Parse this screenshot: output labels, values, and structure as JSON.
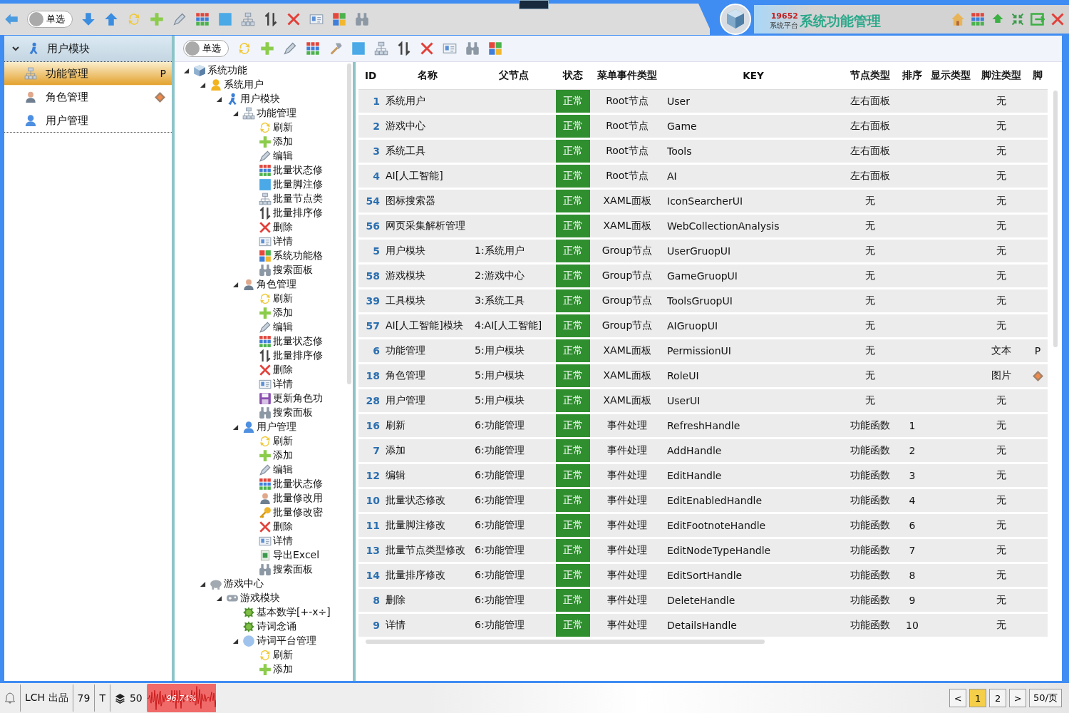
{
  "title_bar": {
    "toolbar": [
      {
        "kind": "back"
      },
      {
        "kind": "toggle",
        "label": "单选",
        "on": false
      },
      {
        "kind": "down"
      },
      {
        "kind": "up"
      },
      {
        "kind": "refresh"
      },
      {
        "kind": "add"
      },
      {
        "kind": "edit"
      },
      {
        "kind": "grid"
      },
      {
        "kind": "square"
      },
      {
        "kind": "tree"
      },
      {
        "kind": "sort"
      },
      {
        "kind": "delete"
      },
      {
        "kind": "card"
      },
      {
        "kind": "tiles"
      },
      {
        "kind": "binoculars"
      }
    ],
    "count": "19652",
    "platform": "系统平台",
    "title": "系统功能管理",
    "controls": [
      {
        "kind": "home"
      },
      {
        "kind": "grid"
      },
      {
        "kind": "upgreen"
      },
      {
        "kind": "shrink"
      },
      {
        "kind": "exit"
      },
      {
        "kind": "close"
      }
    ]
  },
  "sidebar": {
    "header": {
      "label": "用户模块",
      "expanded": true
    },
    "items": [
      {
        "label": "功能管理",
        "kind": "tree",
        "selected": true,
        "tail": {
          "kind": "text",
          "text": "P"
        }
      },
      {
        "label": "角色管理",
        "kind": "role",
        "selected": false,
        "tail": {
          "kind": "diamond"
        }
      },
      {
        "label": "用户管理",
        "kind": "people",
        "selected": false
      }
    ]
  },
  "toolbar": [
    {
      "kind": "toggle",
      "label": "单选",
      "on": false
    },
    {
      "kind": "refresh"
    },
    {
      "kind": "add"
    },
    {
      "kind": "edit"
    },
    {
      "kind": "grid"
    },
    {
      "kind": "hammer"
    },
    {
      "kind": "square"
    },
    {
      "kind": "tree"
    },
    {
      "kind": "sort"
    },
    {
      "kind": "delete"
    },
    {
      "kind": "card"
    },
    {
      "kind": "binoculars"
    },
    {
      "kind": "tiles"
    }
  ],
  "tree": [
    {
      "label": "系统功能",
      "kind": "cube",
      "expanded": true,
      "children": [
        {
          "label": "系统用户",
          "kind": "user",
          "expanded": true,
          "children": [
            {
              "label": "用户模块",
              "kind": "runner",
              "expanded": true,
              "children": [
                {
                  "label": "功能管理",
                  "kind": "tree",
                  "expanded": true,
                  "children": [
                    {
                      "label": "刷新",
                      "kind": "refresh"
                    },
                    {
                      "label": "添加",
                      "kind": "add"
                    },
                    {
                      "label": "编辑",
                      "kind": "edit"
                    },
                    {
                      "label": "批量状态修",
                      "kind": "grid"
                    },
                    {
                      "label": "批量脚注修",
                      "kind": "square"
                    },
                    {
                      "label": "批量节点类",
                      "kind": "tree"
                    },
                    {
                      "label": "批量排序修",
                      "kind": "sort"
                    },
                    {
                      "label": "删除",
                      "kind": "delete"
                    },
                    {
                      "label": "详情",
                      "kind": "card"
                    },
                    {
                      "label": "系统功能格",
                      "kind": "tiles"
                    },
                    {
                      "label": "搜索面板",
                      "kind": "binoculars"
                    }
                  ]
                },
                {
                  "label": "角色管理",
                  "kind": "role",
                  "expanded": true,
                  "children": [
                    {
                      "label": "刷新",
                      "kind": "refresh"
                    },
                    {
                      "label": "添加",
                      "kind": "add"
                    },
                    {
                      "label": "编辑",
                      "kind": "edit"
                    },
                    {
                      "label": "批量状态修",
                      "kind": "grid"
                    },
                    {
                      "label": "批量排序修",
                      "kind": "sort"
                    },
                    {
                      "label": "删除",
                      "kind": "delete"
                    },
                    {
                      "label": "详情",
                      "kind": "card"
                    },
                    {
                      "label": "更新角色功",
                      "kind": "save"
                    },
                    {
                      "label": "搜索面板",
                      "kind": "binoculars"
                    }
                  ]
                },
                {
                  "label": "用户管理",
                  "kind": "people",
                  "expanded": true,
                  "children": [
                    {
                      "label": "刷新",
                      "kind": "refresh"
                    },
                    {
                      "label": "添加",
                      "kind": "add"
                    },
                    {
                      "label": "编辑",
                      "kind": "edit"
                    },
                    {
                      "label": "批量状态修",
                      "kind": "grid"
                    },
                    {
                      "label": "批量修改用",
                      "kind": "role"
                    },
                    {
                      "label": "批量修改密",
                      "kind": "key"
                    },
                    {
                      "label": "删除",
                      "kind": "delete"
                    },
                    {
                      "label": "详情",
                      "kind": "card"
                    },
                    {
                      "label": "导出Excel",
                      "kind": "excel"
                    },
                    {
                      "label": "搜索面板",
                      "kind": "binoculars"
                    }
                  ]
                }
              ]
            }
          ]
        },
        {
          "label": "游戏中心",
          "kind": "elephant",
          "expanded": true,
          "children": [
            {
              "label": "游戏模块",
              "kind": "gamepad",
              "expanded": true,
              "children": [
                {
                  "label": "基本数学[+-x÷]",
                  "kind": "bug"
                },
                {
                  "label": "诗词念诵",
                  "kind": "bug"
                },
                {
                  "label": "诗词平台管理",
                  "kind": "circle",
                  "expanded": true,
                  "children": [
                    {
                      "label": "刷新",
                      "kind": "refresh"
                    },
                    {
                      "label": "添加",
                      "kind": "add"
                    }
                  ]
                }
              ]
            }
          ]
        }
      ]
    }
  ],
  "table": {
    "columns": [
      "ID",
      "名称",
      "父节点",
      "状态",
      "菜单事件类型",
      "KEY",
      "节点类型",
      "排序",
      "显示类型",
      "脚注类型",
      "脚"
    ],
    "rows": [
      {
        "id": "1",
        "name": "系统用户",
        "status": "正常",
        "event_type": "Root节点",
        "key": "User",
        "node_type": "左右面板",
        "footnote_type": "无"
      },
      {
        "id": "2",
        "name": "游戏中心",
        "status": "正常",
        "event_type": "Root节点",
        "key": "Game",
        "node_type": "左右面板",
        "footnote_type": "无"
      },
      {
        "id": "3",
        "name": "系统工具",
        "status": "正常",
        "event_type": "Root节点",
        "key": "Tools",
        "node_type": "左右面板",
        "footnote_type": "无"
      },
      {
        "id": "4",
        "name": "AI[人工智能]",
        "status": "正常",
        "event_type": "Root节点",
        "key": "AI",
        "node_type": "左右面板",
        "footnote_type": "无"
      },
      {
        "id": "54",
        "name": "图标搜索器",
        "status": "正常",
        "event_type": "XAML面板",
        "key": "IconSearcherUI",
        "node_type": "无",
        "footnote_type": "无"
      },
      {
        "id": "56",
        "name": "网页采集解析管理",
        "status": "正常",
        "event_type": "XAML面板",
        "key": "WebCollectionAnalysis",
        "node_type": "无",
        "footnote_type": "无"
      },
      {
        "id": "5",
        "name": "用户模块",
        "parent": "1:系统用户",
        "status": "正常",
        "event_type": "Group节点",
        "key": "UserGruopUI",
        "node_type": "无",
        "footnote_type": "无"
      },
      {
        "id": "58",
        "name": "游戏模块",
        "parent": "2:游戏中心",
        "status": "正常",
        "event_type": "Group节点",
        "key": "GameGruopUI",
        "node_type": "无",
        "footnote_type": "无"
      },
      {
        "id": "39",
        "name": "工具模块",
        "parent": "3:系统工具",
        "status": "正常",
        "event_type": "Group节点",
        "key": "ToolsGruopUI",
        "node_type": "无",
        "footnote_type": "无"
      },
      {
        "id": "57",
        "name": "AI[人工智能]模块",
        "parent": "4:AI[人工智能]",
        "status": "正常",
        "event_type": "Group节点",
        "key": "AIGruopUI",
        "node_type": "无",
        "footnote_type": "无"
      },
      {
        "id": "6",
        "name": "功能管理",
        "parent": "5:用户模块",
        "status": "正常",
        "event_type": "XAML面板",
        "key": "PermissionUI",
        "node_type": "无",
        "footnote_type": "文本",
        "tail": {
          "kind": "text",
          "text": "P"
        }
      },
      {
        "id": "18",
        "name": "角色管理",
        "parent": "5:用户模块",
        "status": "正常",
        "event_type": "XAML面板",
        "key": "RoleUI",
        "node_type": "无",
        "footnote_type": "图片",
        "tail": {
          "kind": "diamond"
        }
      },
      {
        "id": "28",
        "name": "用户管理",
        "parent": "5:用户模块",
        "status": "正常",
        "event_type": "XAML面板",
        "key": "UserUI",
        "node_type": "无",
        "footnote_type": "无"
      },
      {
        "id": "16",
        "name": "刷新",
        "parent": "6:功能管理",
        "status": "正常",
        "event_type": "事件处理",
        "key": "RefreshHandle",
        "node_type": "功能函数",
        "sort": "1",
        "footnote_type": "无"
      },
      {
        "id": "7",
        "name": "添加",
        "parent": "6:功能管理",
        "status": "正常",
        "event_type": "事件处理",
        "key": "AddHandle",
        "node_type": "功能函数",
        "sort": "2",
        "footnote_type": "无"
      },
      {
        "id": "12",
        "name": "编辑",
        "parent": "6:功能管理",
        "status": "正常",
        "event_type": "事件处理",
        "key": "EditHandle",
        "node_type": "功能函数",
        "sort": "3",
        "footnote_type": "无"
      },
      {
        "id": "10",
        "name": "批量状态修改",
        "parent": "6:功能管理",
        "status": "正常",
        "event_type": "事件处理",
        "key": "EditEnabledHandle",
        "node_type": "功能函数",
        "sort": "4",
        "footnote_type": "无"
      },
      {
        "id": "11",
        "name": "批量脚注修改",
        "parent": "6:功能管理",
        "status": "正常",
        "event_type": "事件处理",
        "key": "EditFootnoteHandle",
        "node_type": "功能函数",
        "sort": "6",
        "footnote_type": "无"
      },
      {
        "id": "13",
        "name": "批量节点类型修改",
        "parent": "6:功能管理",
        "status": "正常",
        "event_type": "事件处理",
        "key": "EditNodeTypeHandle",
        "node_type": "功能函数",
        "sort": "7",
        "footnote_type": "无"
      },
      {
        "id": "14",
        "name": "批量排序修改",
        "parent": "6:功能管理",
        "status": "正常",
        "event_type": "事件处理",
        "key": "EditSortHandle",
        "node_type": "功能函数",
        "sort": "8",
        "footnote_type": "无"
      },
      {
        "id": "8",
        "name": "删除",
        "parent": "6:功能管理",
        "status": "正常",
        "event_type": "事件处理",
        "key": "DeleteHandle",
        "node_type": "功能函数",
        "sort": "9",
        "footnote_type": "无"
      },
      {
        "id": "9",
        "name": "详情",
        "parent": "6:功能管理",
        "status": "正常",
        "event_type": "事件处理",
        "key": "DetailsHandle",
        "node_type": "功能函数",
        "sort": "10",
        "footnote_type": "无"
      }
    ]
  },
  "status_bar": {
    "brand": "LCH 出品",
    "count": "79",
    "letter": "T",
    "layers": "50",
    "load": "96.74%"
  },
  "pager": [
    {
      "label": "<",
      "selected": false
    },
    {
      "label": "1",
      "selected": true
    },
    {
      "label": "2",
      "selected": false
    },
    {
      "label": ">",
      "selected": false
    },
    {
      "label": "50/页",
      "selected": false
    }
  ]
}
